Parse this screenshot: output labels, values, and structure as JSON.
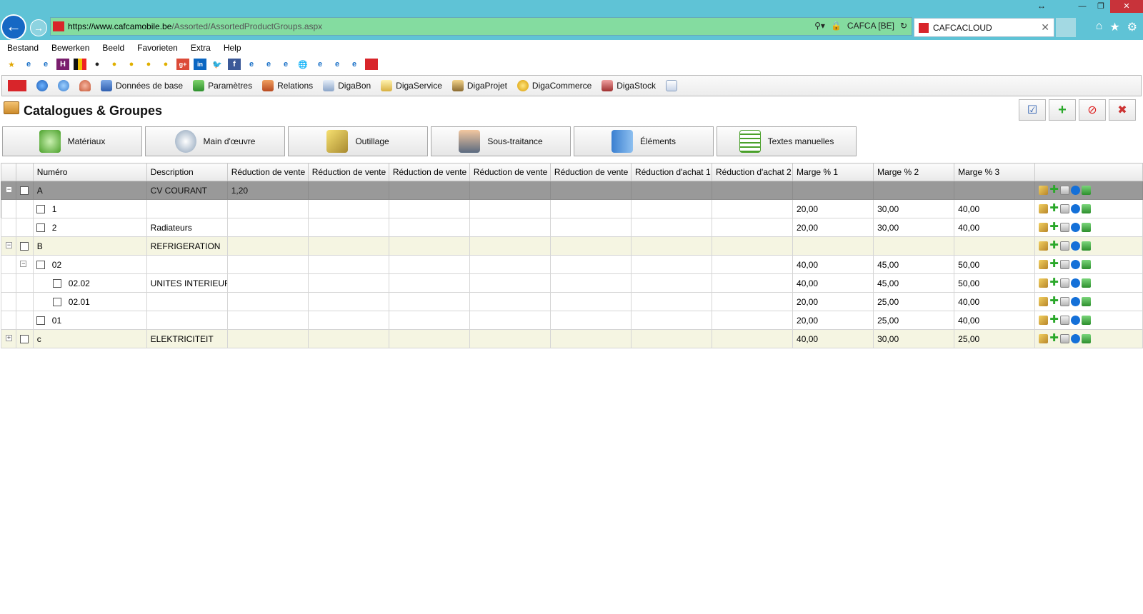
{
  "browser": {
    "url_domain": "https://www.cafcamobile.be",
    "url_path": "/Assorted/AssortedProductGroups.aspx",
    "site_identity": "CAFCA [BE]",
    "tab_title": "CAFCACLOUD",
    "menu": [
      "Bestand",
      "Bewerken",
      "Beeld",
      "Favorieten",
      "Extra",
      "Help"
    ]
  },
  "appbar": {
    "items": [
      "Données de base",
      "Paramètres",
      "Relations",
      "DigaBon",
      "DigaService",
      "DigaProjet",
      "DigaCommerce",
      "DigaStock"
    ]
  },
  "page": {
    "title": "Catalogues & Groupes"
  },
  "category_tabs": [
    "Matériaux",
    "Main d'œuvre",
    "Outillage",
    "Sous-traitance",
    "Éléments",
    "Textes manuelles"
  ],
  "grid": {
    "columns": [
      "Numéro",
      "Description",
      "Réduction de vente",
      "Réduction de vente",
      "Réduction de vente",
      "Réduction de vente",
      "Réduction de vente",
      "Réduction d'achat 1",
      "Réduction d'achat 2",
      "Marge % 1",
      "Marge % 2",
      "Marge % 3"
    ],
    "rows": [
      {
        "numero": "A",
        "description": "CV COURANT",
        "rv1": "1,20",
        "m1": "",
        "m2": "",
        "m3": ""
      },
      {
        "numero": "1",
        "description": "",
        "rv1": "",
        "m1": "20,00",
        "m2": "30,00",
        "m3": "40,00"
      },
      {
        "numero": "2",
        "description": "Radiateurs",
        "rv1": "",
        "m1": "20,00",
        "m2": "30,00",
        "m3": "40,00"
      },
      {
        "numero": "B",
        "description": "REFRIGERATION",
        "rv1": "",
        "m1": "",
        "m2": "",
        "m3": ""
      },
      {
        "numero": "02",
        "description": "",
        "rv1": "",
        "m1": "40,00",
        "m2": "45,00",
        "m3": "50,00"
      },
      {
        "numero": "02.02",
        "description": "UNITES INTERIEURS",
        "rv1": "",
        "m1": "40,00",
        "m2": "45,00",
        "m3": "50,00"
      },
      {
        "numero": "02.01",
        "description": "",
        "rv1": "",
        "m1": "20,00",
        "m2": "25,00",
        "m3": "40,00"
      },
      {
        "numero": "01",
        "description": "",
        "rv1": "",
        "m1": "20,00",
        "m2": "25,00",
        "m3": "40,00"
      },
      {
        "numero": "c",
        "description": "ELEKTRICITEIT",
        "rv1": "",
        "m1": "40,00",
        "m2": "30,00",
        "m3": "25,00"
      }
    ]
  }
}
